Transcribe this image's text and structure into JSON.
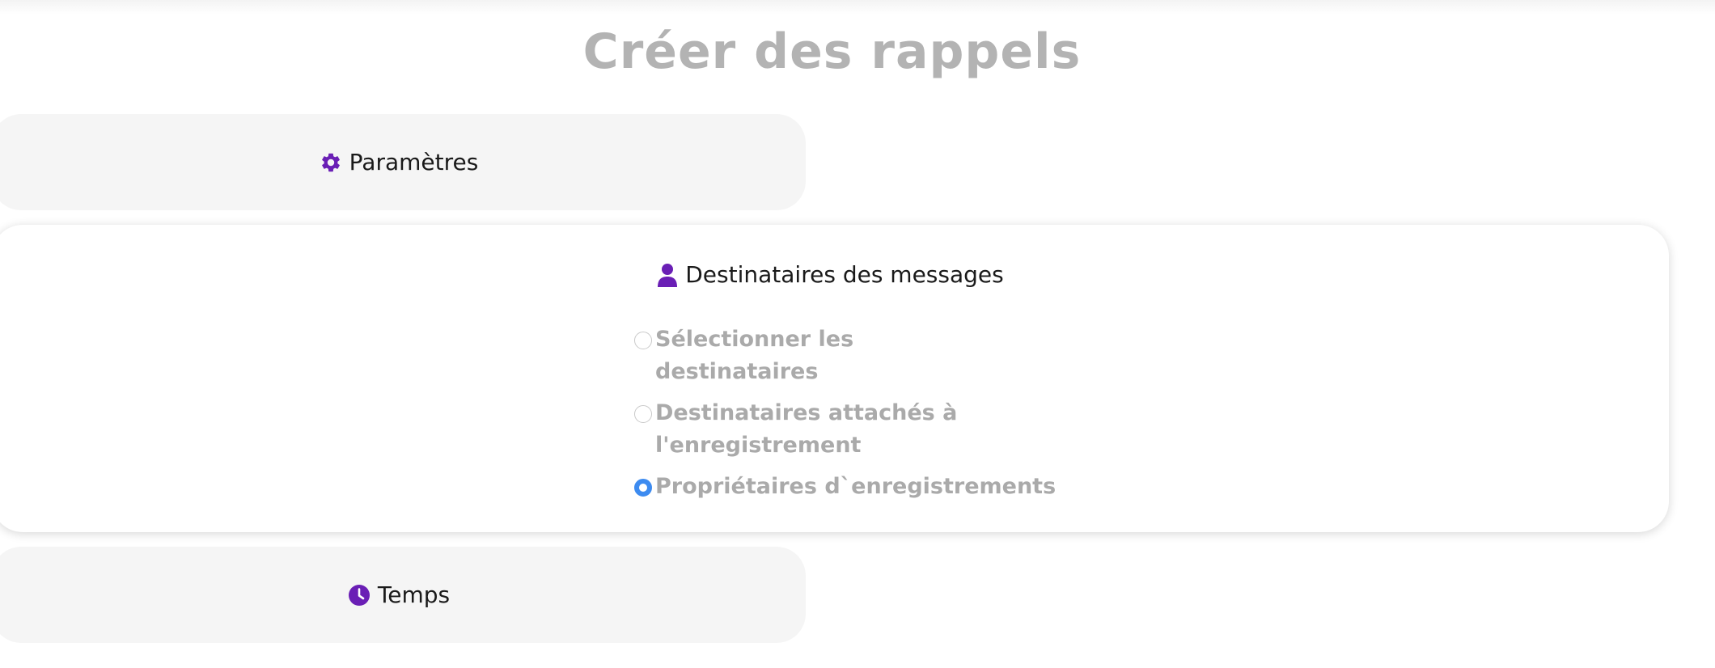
{
  "page": {
    "title": "Créer des rappels"
  },
  "sections": {
    "params": {
      "label": "Paramètres",
      "icon": "gear-icon"
    },
    "recipients": {
      "label": "Destinataires des messages",
      "icon": "user-icon"
    },
    "temps": {
      "label": "Temps",
      "icon": "clock-icon"
    }
  },
  "recipient_options": [
    {
      "label": "Sélectionner les destinataires",
      "selected": false
    },
    {
      "label": "Destinataires attachés à l'enregistrement",
      "selected": false
    },
    {
      "label": "Propriétaires d`enregistrements",
      "selected": true
    }
  ],
  "colors": {
    "icon_accent": "#6a1fb5",
    "radio_selected": "#3d8bf0",
    "title_gray": "#b3b3b3"
  }
}
